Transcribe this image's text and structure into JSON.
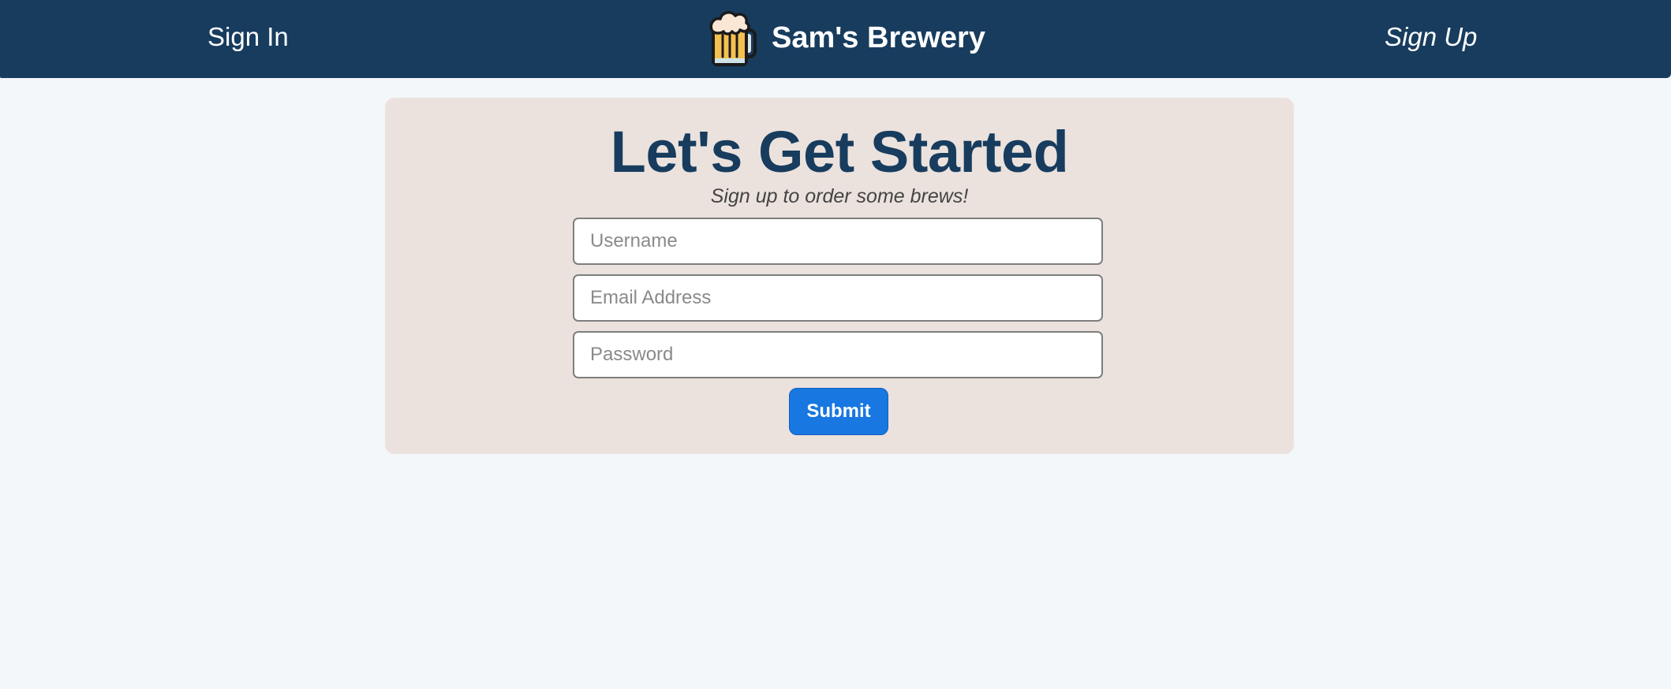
{
  "nav": {
    "sign_in": "Sign In",
    "brand_name": "Sam's Brewery",
    "brand_icon": "beer-mug-icon",
    "sign_up": "Sign Up"
  },
  "form": {
    "title": "Let's Get Started",
    "subtitle": "Sign up to order some brews!",
    "username_placeholder": "Username",
    "email_placeholder": "Email Address",
    "password_placeholder": "Password",
    "submit_label": "Submit"
  },
  "colors": {
    "navbar": "#173c5e",
    "page_background": "#f4f7fa",
    "card_background": "#ebe2dd",
    "title": "#173c5e",
    "submit_button": "#1877e0"
  }
}
